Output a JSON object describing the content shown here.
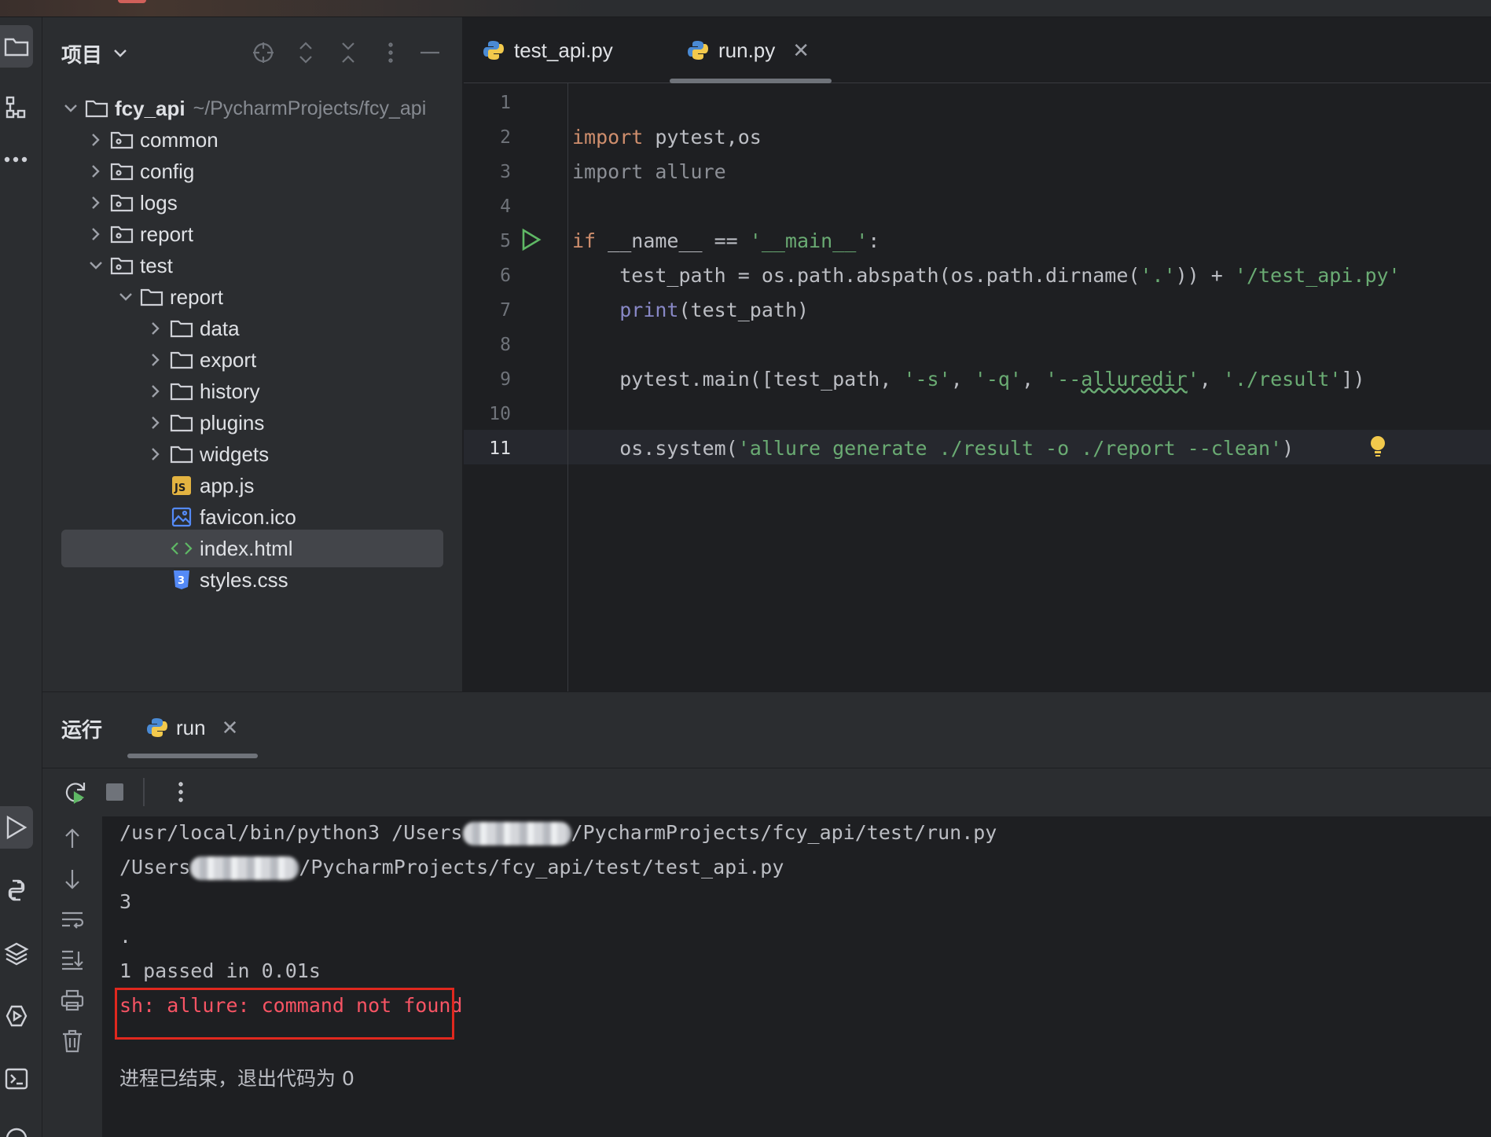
{
  "project_panel": {
    "title": "项目",
    "root": {
      "name": "fcy_api",
      "path": "~/PycharmProjects/fcy_api"
    },
    "items": [
      {
        "label": "common"
      },
      {
        "label": "config"
      },
      {
        "label": "logs"
      },
      {
        "label": "report"
      },
      {
        "label": "test"
      },
      {
        "label": "report"
      },
      {
        "label": "data"
      },
      {
        "label": "export"
      },
      {
        "label": "history"
      },
      {
        "label": "plugins"
      },
      {
        "label": "widgets"
      },
      {
        "label": "app.js"
      },
      {
        "label": "favicon.ico"
      },
      {
        "label": "index.html"
      },
      {
        "label": "styles.css"
      }
    ],
    "selected": "index.html"
  },
  "editor": {
    "tabs": [
      {
        "label": "test_api.py"
      },
      {
        "label": "run.py"
      }
    ],
    "active_tab": "run.py",
    "line_numbers": [
      "1",
      "2",
      "3",
      "4",
      "5",
      "6",
      "7",
      "8",
      "9",
      "10",
      "11"
    ],
    "current_line": "11",
    "code": {
      "l2_kw": "import",
      "l2_rest": " pytest,os",
      "l3_kw": "import",
      "l3_rest": " allure",
      "l5_kw": "if",
      "l5_mid": " __name__ == ",
      "l5_str": "'__main__'",
      "l5_end": ":",
      "l6_a": "    test_path = os.path.abspath(os.path.dirname(",
      "l6_s1": "'.'",
      "l6_b": ")) + ",
      "l6_s2": "'/test_api.py'",
      "l7_indent": "    ",
      "l7_fn": "print",
      "l7_rest": "(test_path)",
      "l9_a": "    pytest.main([test_path, ",
      "l9_s1": "'-s'",
      "l9_c1": ", ",
      "l9_s2": "'-q'",
      "l9_c2": ", ",
      "l9_s3a": "'--",
      "l9_s3b": "alluredir",
      "l9_s3c": "'",
      "l9_c3": ", ",
      "l9_s4": "'./result'",
      "l9_end": "])",
      "l11_a": "    os.system(",
      "l11_s": "'allure generate ./result -o ./report --clean'",
      "l11_end": ")"
    }
  },
  "run_panel": {
    "title": "运行",
    "tab": "run",
    "output": {
      "line1_a": "/usr/local/bin/python3 /Users",
      "line1_b": "/PycharmProjects/fcy_api/test/run.py",
      "line2_a": "/Users",
      "line2_b": "/PycharmProjects/fcy_api/test/test_api.py",
      "line3": "3",
      "line4": ".",
      "line5": "1 passed in 0.01s",
      "error": "sh: allure: command not found",
      "exit": "进程已结束，退出代码为 0"
    }
  },
  "colors": {
    "background": "#1e1f22",
    "panel": "#2b2d30",
    "keyword": "#cf8e6d",
    "string": "#6aab73",
    "builtin": "#8888c6",
    "error_text": "#f75464",
    "error_box": "#e0281e",
    "run_green": "#5fb865"
  },
  "icons": [
    "folder-icon",
    "structure-icon",
    "more-icon",
    "run-icon",
    "python-console-icon",
    "layers-icon",
    "services-icon",
    "terminal-icon",
    "locate-icon",
    "expand-all-icon",
    "collapse-all-icon",
    "options-icon",
    "hide-icon",
    "rerun-icon",
    "stop-icon",
    "scroll-up-icon",
    "scroll-down-icon",
    "soft-wrap-icon",
    "scroll-to-end-icon",
    "print-icon",
    "trash-icon",
    "python-file-icon",
    "js-file-icon",
    "image-file-icon",
    "html-file-icon",
    "css-file-icon",
    "lightbulb-icon"
  ]
}
